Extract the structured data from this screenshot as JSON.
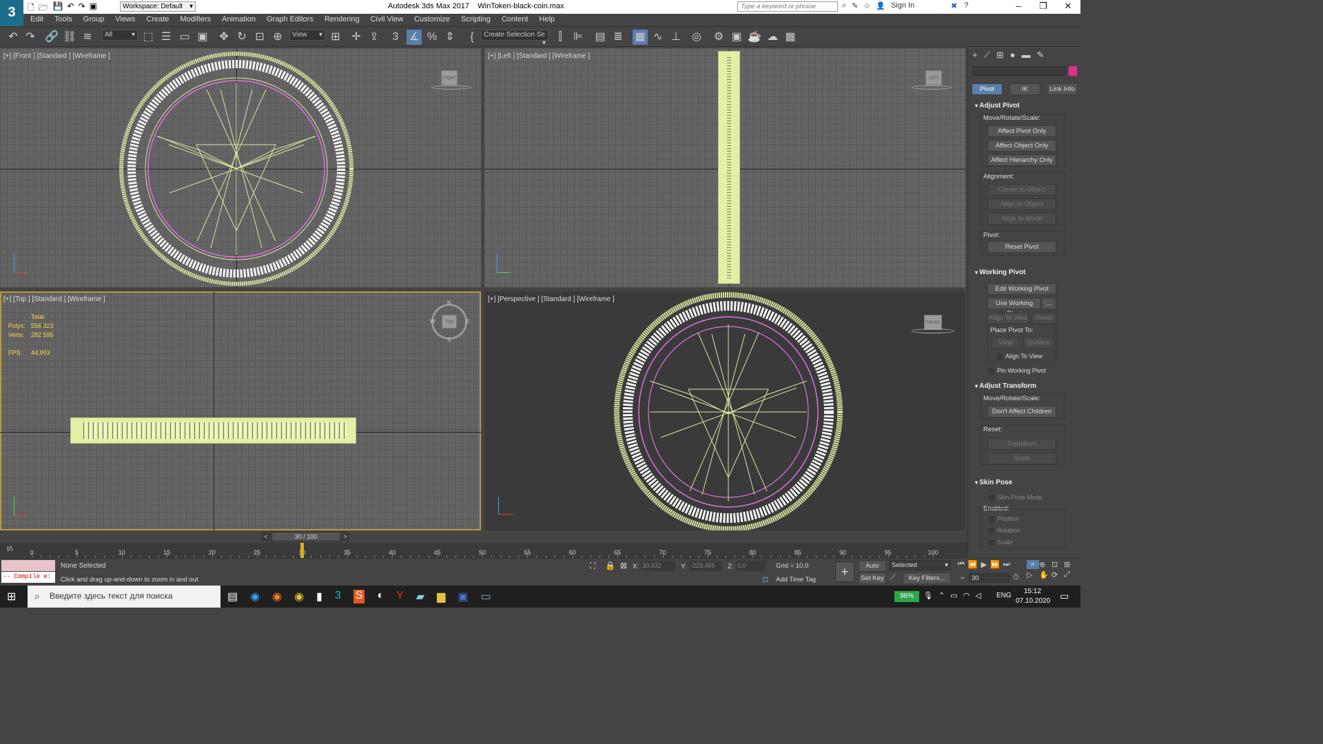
{
  "window": {
    "title": "Autodesk 3ds Max 2017    WinToken-black-coin.max",
    "workspace": "Workspace: Default",
    "search_placeholder": "Type a keyword or phrase",
    "sign_in": "Sign In"
  },
  "menu": [
    "Edit",
    "Tools",
    "Group",
    "Views",
    "Create",
    "Modifiers",
    "Animation",
    "Graph Editors",
    "Rendering",
    "Civil View",
    "Customize",
    "Scripting",
    "Content",
    "Help"
  ],
  "toolbar": {
    "filter": "All",
    "ref_coord": "View",
    "selection_set": "Create Selection Se"
  },
  "viewports": {
    "front": "[+] [Front ] [Standard ] [Wireframe ]",
    "left": "[+] [Left ] [Standard ] [Wireframe ]",
    "top": "[+] [Top ] [Standard ] [Wireframe ]",
    "perspective": "[+] [Perspective ] [Standard ] [Wireframe ]",
    "viewcube": {
      "front": "FRONT",
      "left": "LEFT",
      "top": "TOP",
      "n": "N",
      "s": "S",
      "w": "W",
      "e": "E"
    }
  },
  "stats": {
    "total": "Total",
    "polys_label": "Polys:",
    "polys": "556 323",
    "verts_label": "Verts:",
    "verts": "282 595",
    "fps_label": "FPS:",
    "fps": "44,993"
  },
  "command_panel": {
    "tabs": [
      "Pivot",
      "IK",
      "Link Info"
    ],
    "adjust_pivot": {
      "title": "Adjust Pivot",
      "move_label": "Move/Rotate/Scale:",
      "buttons": [
        "Affect Pivot Only",
        "Affect Object Only",
        "Affect Hierarchy Only"
      ],
      "alignment_label": "Alignment:",
      "align_buttons": [
        "Center to Object",
        "Align to Object",
        "Align to World"
      ],
      "pivot_label": "Pivot:",
      "reset": "Reset Pivot"
    },
    "working_pivot": {
      "title": "Working Pivot",
      "edit": "Edit Working Pivot",
      "use": "Use Working Pivot",
      "ellipsis": "...",
      "align_to_view": "Align To View",
      "reset": "Reset",
      "place_label": "Place Pivot To:",
      "view": "View",
      "surface": "Surface",
      "align_view_check": "Align To View",
      "pin": "Pin Working Pivot"
    },
    "adjust_transform": {
      "title": "Adjust Transform",
      "move_label": "Move/Rotate/Scale:",
      "dont_affect": "Don't Affect Children",
      "reset_label": "Reset:",
      "transform": "Transform",
      "scale": "Scale"
    },
    "skin_pose": {
      "title": "Skin Pose",
      "mode": "Skin Pose Mode",
      "enabled_label": "Enabled:",
      "position": "Position",
      "rotation": "Rotation",
      "scale": "Scale"
    }
  },
  "timeline": {
    "frame": "30 / 100",
    "ticks": [
      "0",
      "5",
      "10",
      "15",
      "20",
      "25",
      "30",
      "35",
      "40",
      "45",
      "50",
      "55",
      "60",
      "65",
      "70",
      "75",
      "80",
      "85",
      "90",
      "95",
      "100"
    ],
    "current_frame": 30
  },
  "status": {
    "script_output": "-- Compile e:",
    "selection": "None Selected",
    "prompt": "Click and drag up-and-down to zoom in and out",
    "x_label": "X:",
    "x": "30,432",
    "y_label": "Y:",
    "y": "-229,465",
    "z_label": "Z:",
    "z": "0,0",
    "grid": "Grid = 10,0",
    "add_time_tag": "Add Time Tag",
    "auto_key": "Auto Key",
    "set_key": "Set Key",
    "selected": "Selected",
    "key_filters": "Key Filters...",
    "frame_field": "30"
  },
  "taskbar": {
    "search_placeholder": "Введите здесь текст для поиска",
    "battery": "96%",
    "lang": "ENG",
    "time": "15:12",
    "date": "07.10.2020"
  },
  "colors": {
    "accent": "#5b7fa8",
    "wire": "#d8e8a0",
    "pink": "#e070e0",
    "active_border": "#b79c3a"
  }
}
